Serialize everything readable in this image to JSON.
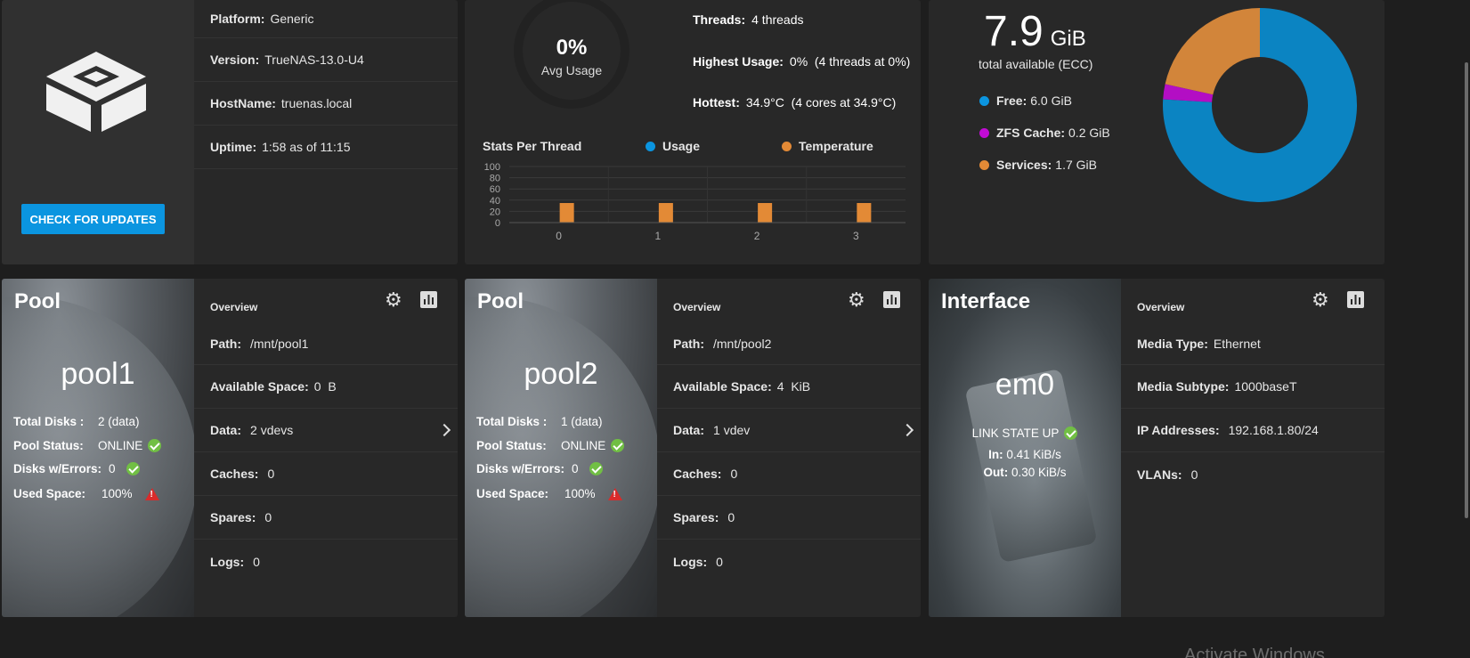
{
  "sysinfo": {
    "rows": [
      {
        "label": "Platform:",
        "value": "Generic"
      },
      {
        "label": "Version:",
        "value": "TrueNAS-13.0-U4"
      },
      {
        "label": "HostName:",
        "value": "truenas.local"
      },
      {
        "label": "Uptime:",
        "value": "1:58 as of 11:15"
      }
    ],
    "update_button": "CHECK FOR UPDATES"
  },
  "cpu": {
    "avg_value": "0%",
    "avg_label": "Avg Usage",
    "threads_label": "Threads:",
    "threads_value": "4 threads",
    "highest_label": "Highest Usage:",
    "highest_value": "0%  (4 threads at 0%)",
    "hottest_label": "Hottest:",
    "hottest_value": "34.9°C  (4 cores at 34.9°C)",
    "stats_title": "Stats Per Thread",
    "legend_usage": "Usage",
    "legend_temp": "Temperature",
    "usage_color": "#0b95e0",
    "temp_color": "#e38a36"
  },
  "chart_data": {
    "type": "bar",
    "categories": [
      "0",
      "1",
      "2",
      "3"
    ],
    "series": [
      {
        "name": "Usage",
        "values": [
          0,
          0,
          0,
          0
        ]
      },
      {
        "name": "Temperature",
        "values": [
          34.9,
          34.9,
          34.9,
          34.9
        ]
      }
    ],
    "y_ticks": [
      "100",
      "80",
      "60",
      "40",
      "20",
      "0"
    ],
    "ylim": [
      0,
      100
    ]
  },
  "memory": {
    "total_value": "7.9",
    "total_unit": "GiB",
    "total_label": "total available (ECC)",
    "legend": [
      {
        "label": "Free:",
        "value": "6.0 GiB",
        "color": "#0b84c2",
        "gib": 6.0
      },
      {
        "label": "ZFS Cache:",
        "value": "0.2 GiB",
        "color": "#b30ec4",
        "gib": 0.2
      },
      {
        "label": "Services:",
        "value": "1.7 GiB",
        "color": "#d2853a",
        "gib": 1.7
      }
    ]
  },
  "pools": [
    {
      "title": "Pool",
      "name": "pool1",
      "total_disks_label": "Total Disks :",
      "total_disks": "2 (data)",
      "status_label": "Pool Status:",
      "status": "ONLINE",
      "errors_label": "Disks w/Errors:",
      "errors": "0",
      "used_label": "Used Space:",
      "used": "100%",
      "overview": "Overview",
      "rows": [
        {
          "label": "Path:",
          "value": "/mnt/pool1"
        },
        {
          "label": "Available Space:",
          "value": "0  B"
        },
        {
          "label": "Data:",
          "value": "2 vdevs"
        },
        {
          "label": "Caches:",
          "value": "0"
        },
        {
          "label": "Spares:",
          "value": "0"
        },
        {
          "label": "Logs:",
          "value": "0"
        }
      ]
    },
    {
      "title": "Pool",
      "name": "pool2",
      "total_disks_label": "Total Disks :",
      "total_disks": "1 (data)",
      "status_label": "Pool Status:",
      "status": "ONLINE",
      "errors_label": "Disks w/Errors:",
      "errors": "0",
      "used_label": "Used Space:",
      "used": "100%",
      "overview": "Overview",
      "rows": [
        {
          "label": "Path:",
          "value": "/mnt/pool2"
        },
        {
          "label": "Available Space:",
          "value": "4  KiB"
        },
        {
          "label": "Data:",
          "value": "1 vdev"
        },
        {
          "label": "Caches:",
          "value": "0"
        },
        {
          "label": "Spares:",
          "value": "0"
        },
        {
          "label": "Logs:",
          "value": "0"
        }
      ]
    }
  ],
  "interface": {
    "title": "Interface",
    "name": "em0",
    "link_state": "LINK STATE UP",
    "in_label": "In:",
    "in_value": "0.41 KiB/s",
    "out_label": "Out:",
    "out_value": "0.30 KiB/s",
    "overview": "Overview",
    "rows": [
      {
        "label": "Media Type:",
        "value": "Ethernet"
      },
      {
        "label": "Media Subtype:",
        "value": "1000baseT"
      },
      {
        "label": "IP Addresses:",
        "value": "192.168.1.80/24"
      },
      {
        "label": "VLANs:",
        "value": "0"
      }
    ]
  },
  "watermark": "Activate Windows"
}
